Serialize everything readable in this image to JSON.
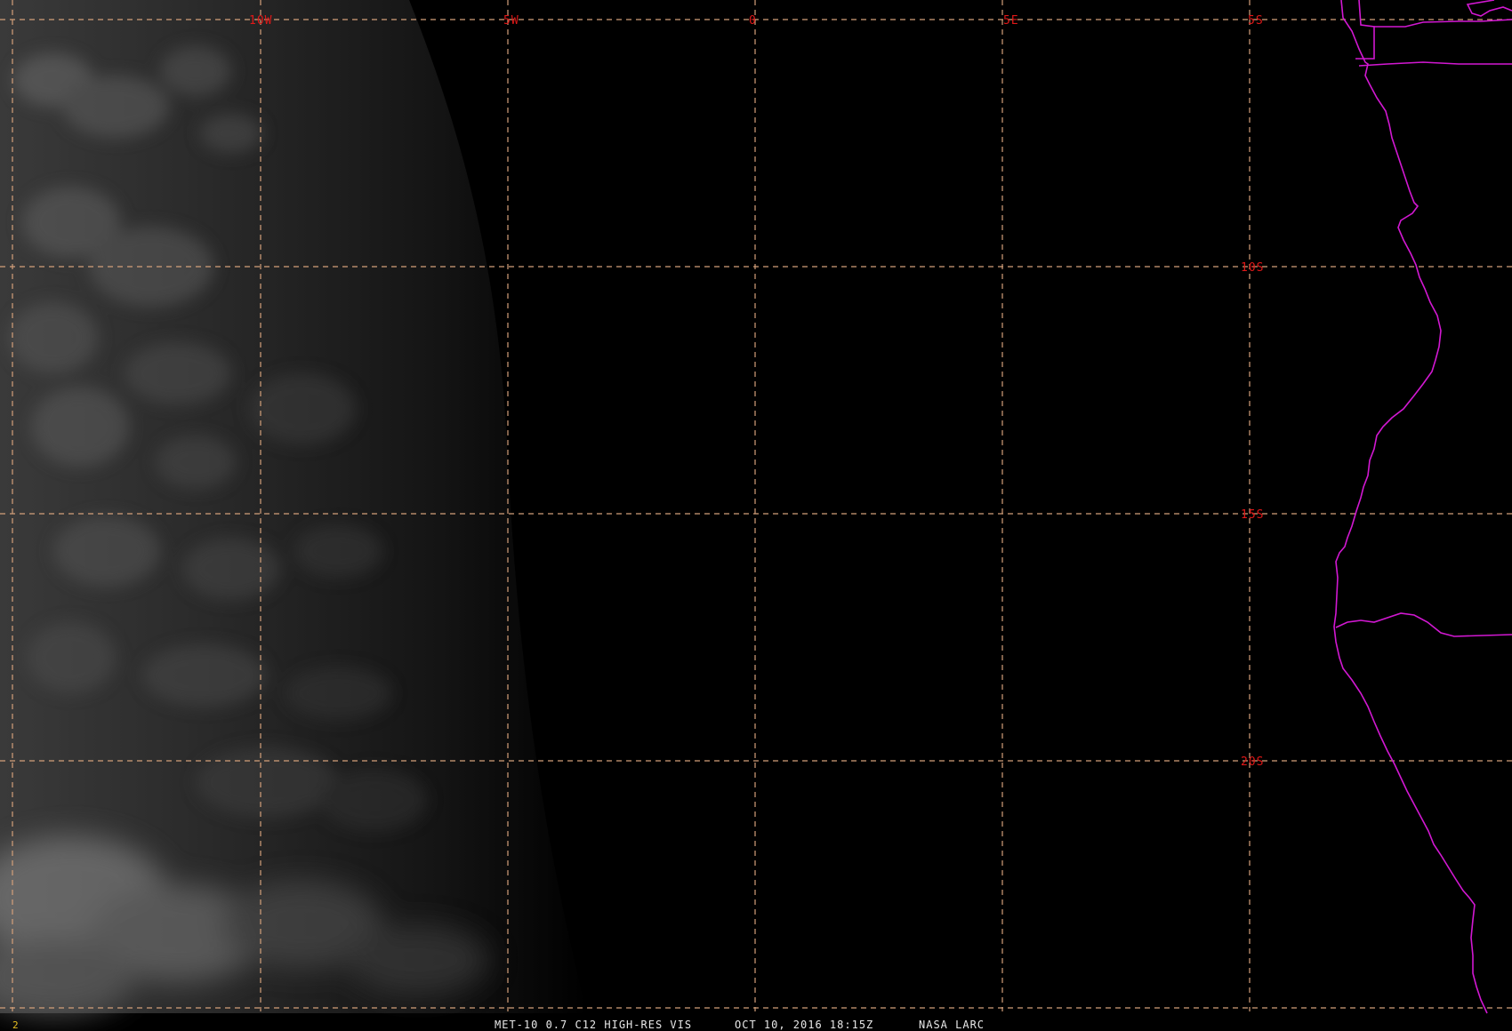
{
  "frame_number": "2",
  "caption": {
    "satellite_band": "MET-10 0.7 C12 HIGH-RES VIS",
    "datetime": "OCT 10, 2016 18:15Z",
    "source": "NASA LARC"
  },
  "colors": {
    "background": "#000000",
    "grid": "#d4a07a",
    "grid_labels": "#e01818",
    "coastline": "#d218d2",
    "caption_text": "#e8e8e8",
    "frame_number": "#e8c020"
  },
  "graticule": {
    "longitude_labels": [
      "10W",
      "5W",
      "0",
      "5E"
    ],
    "latitude_labels": [
      "5S",
      "10S",
      "15S",
      "20S"
    ]
  }
}
